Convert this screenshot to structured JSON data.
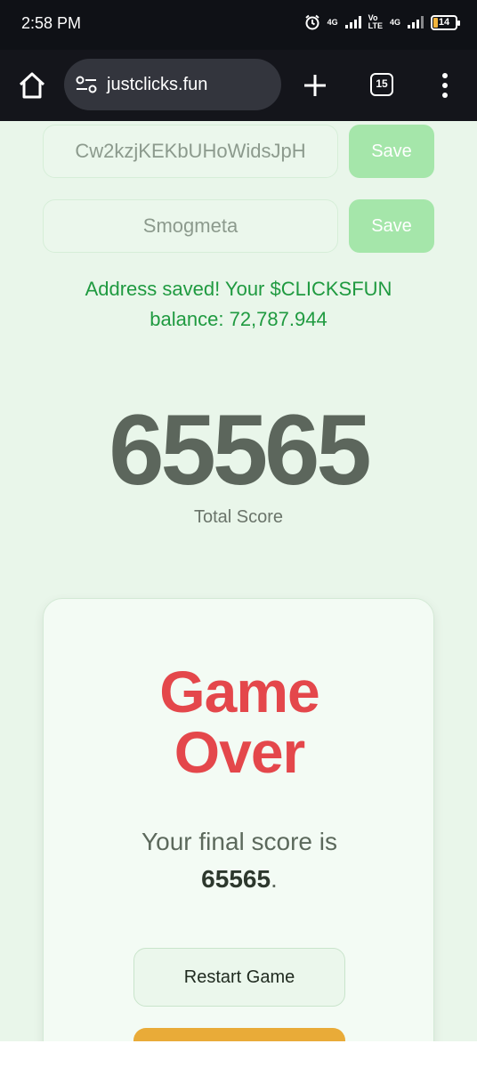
{
  "status": {
    "time": "2:58 PM",
    "sim1": "4G",
    "sim2_top": "Vo",
    "sim2_bottom": "LTE",
    "sim3": "4G",
    "battery": "14"
  },
  "browser": {
    "url": "justclicks.fun",
    "tab_count": "15"
  },
  "form": {
    "address_value": "Cw2kzjKEKbUHoWidsJpH",
    "name_value": "Smogmeta",
    "save_label": "Save",
    "save_label_2": "Save"
  },
  "message": {
    "line1": "Address saved! Your $CLICKSFUN",
    "line2": "balance: 72,787.944"
  },
  "score": {
    "total": "65565",
    "total_label": "Total Score"
  },
  "game_over": {
    "title_line1": "Game",
    "title_line2": "Over",
    "final_prefix": "Your final score is",
    "final_score": "65565",
    "final_suffix": ".",
    "restart_label": "Restart Game"
  },
  "colors": {
    "accent_green": "#1f9a40",
    "save_green": "#a5e6aa",
    "game_over_red": "#e4474b",
    "orange": "#e9ab38"
  }
}
